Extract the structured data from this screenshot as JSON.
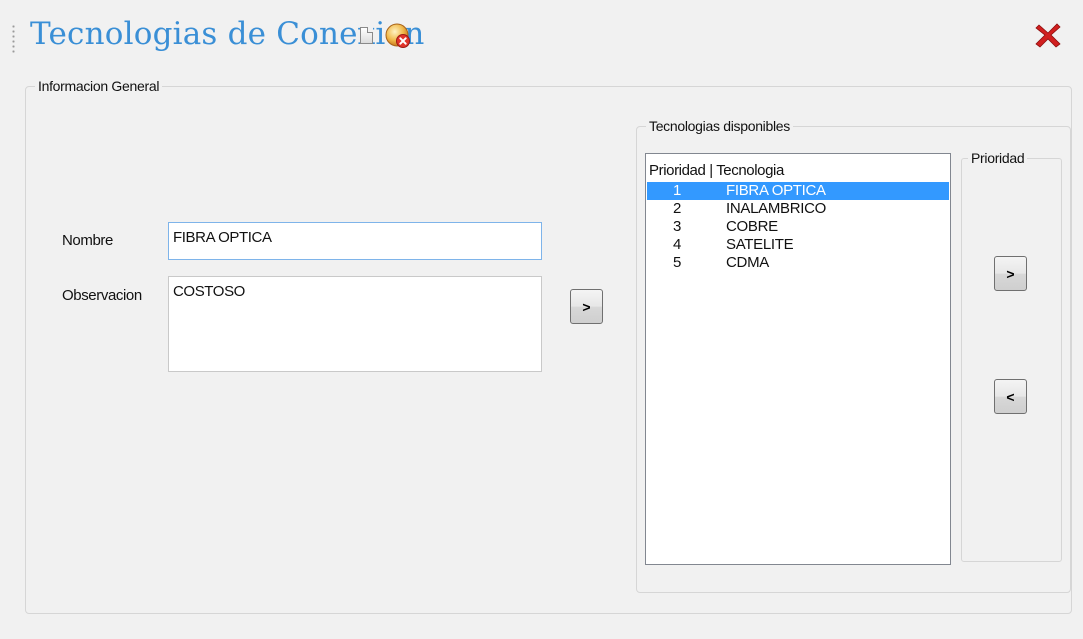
{
  "window": {
    "title": "Tecnologias de Conexion",
    "icons": [
      "new-document-icon",
      "cancel-icon",
      "close-icon"
    ],
    "accent_color": "#3a8fd6",
    "close_color": "#d11f1f"
  },
  "general": {
    "legend": "Informacion General",
    "nombre_label": "Nombre",
    "nombre_value": "FIBRA OPTICA",
    "observacion_label": "Observacion",
    "observacion_value": "COSTOSO",
    "add_button_label": ">"
  },
  "techs": {
    "legend": "Tecnologias disponibles",
    "list_header": "Prioridad | Tecnologia",
    "selected_color": "#3399ff",
    "items": [
      {
        "priority": "1",
        "name": "FIBRA OPTICA",
        "selected": true
      },
      {
        "priority": "2",
        "name": "INALAMBRICO",
        "selected": false
      },
      {
        "priority": "3",
        "name": "COBRE",
        "selected": false
      },
      {
        "priority": "4",
        "name": "SATELITE",
        "selected": false
      },
      {
        "priority": "5",
        "name": "CDMA",
        "selected": false
      }
    ]
  },
  "priority": {
    "legend": "Prioridad",
    "up_label": ">",
    "down_label": "<"
  }
}
